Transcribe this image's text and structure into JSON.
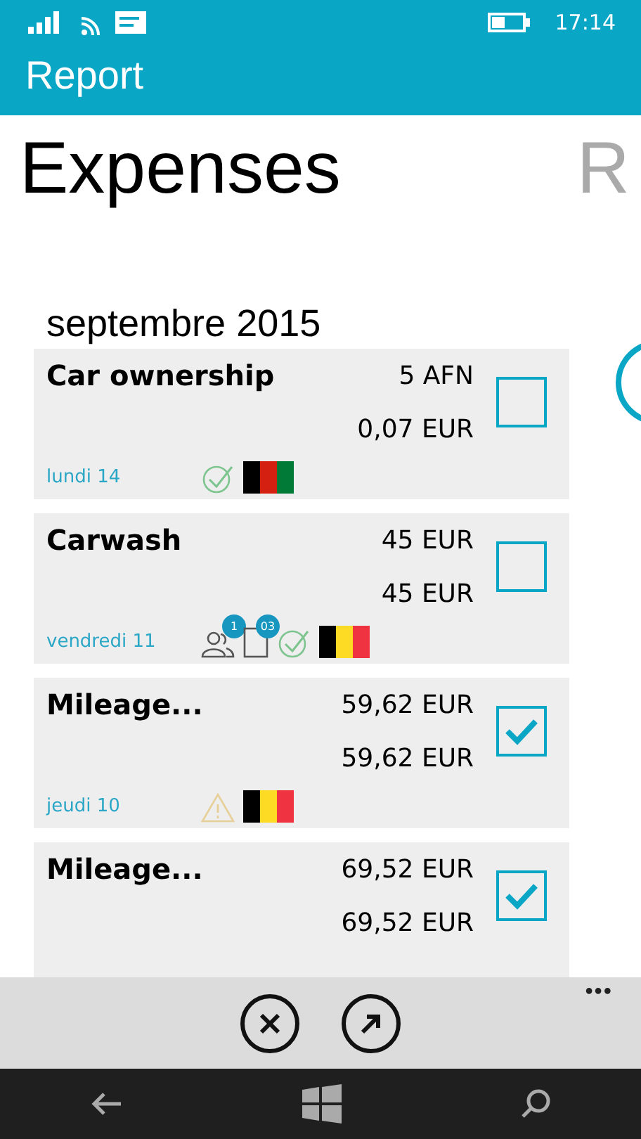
{
  "status_bar": {
    "time": "17:14"
  },
  "header": {
    "title": "Report"
  },
  "pivot": [
    {
      "label": "Expenses",
      "selected": true
    },
    {
      "label": "R",
      "selected": false
    }
  ],
  "group": {
    "title": "septembre 2015"
  },
  "expenses": [
    {
      "name": "Car ownership",
      "amount": "5 AFN",
      "converted": "0,07 EUR",
      "date": "lundi 14",
      "checked": false,
      "indicators": [
        {
          "kind": "approved"
        },
        {
          "kind": "flag",
          "stripes": [
            {
              "color": "#000000"
            },
            {
              "color": "#d32011"
            },
            {
              "color": "#007a36"
            }
          ]
        }
      ]
    },
    {
      "name": "Carwash",
      "amount": "45 EUR",
      "converted": "45 EUR",
      "date": "vendredi 11",
      "checked": false,
      "indicators": [
        {
          "kind": "people",
          "count": "1"
        },
        {
          "kind": "document",
          "count": "03"
        },
        {
          "kind": "approved"
        },
        {
          "kind": "flag",
          "stripes": [
            {
              "color": "#000000"
            },
            {
              "color": "#fdda24"
            },
            {
              "color": "#ef3340"
            }
          ]
        }
      ]
    },
    {
      "name": "Mileage...",
      "amount": "59,62 EUR",
      "converted": "59,62 EUR",
      "date": "jeudi 10",
      "checked": true,
      "indicators": [
        {
          "kind": "warning"
        },
        {
          "kind": "flag",
          "stripes": [
            {
              "color": "#000000"
            },
            {
              "color": "#fdda24"
            },
            {
              "color": "#ef3340"
            }
          ]
        }
      ]
    },
    {
      "name": "Mileage...",
      "amount": "69,52 EUR",
      "converted": "69,52 EUR",
      "checked": true
    }
  ],
  "app_bar": {
    "more": "•••"
  }
}
